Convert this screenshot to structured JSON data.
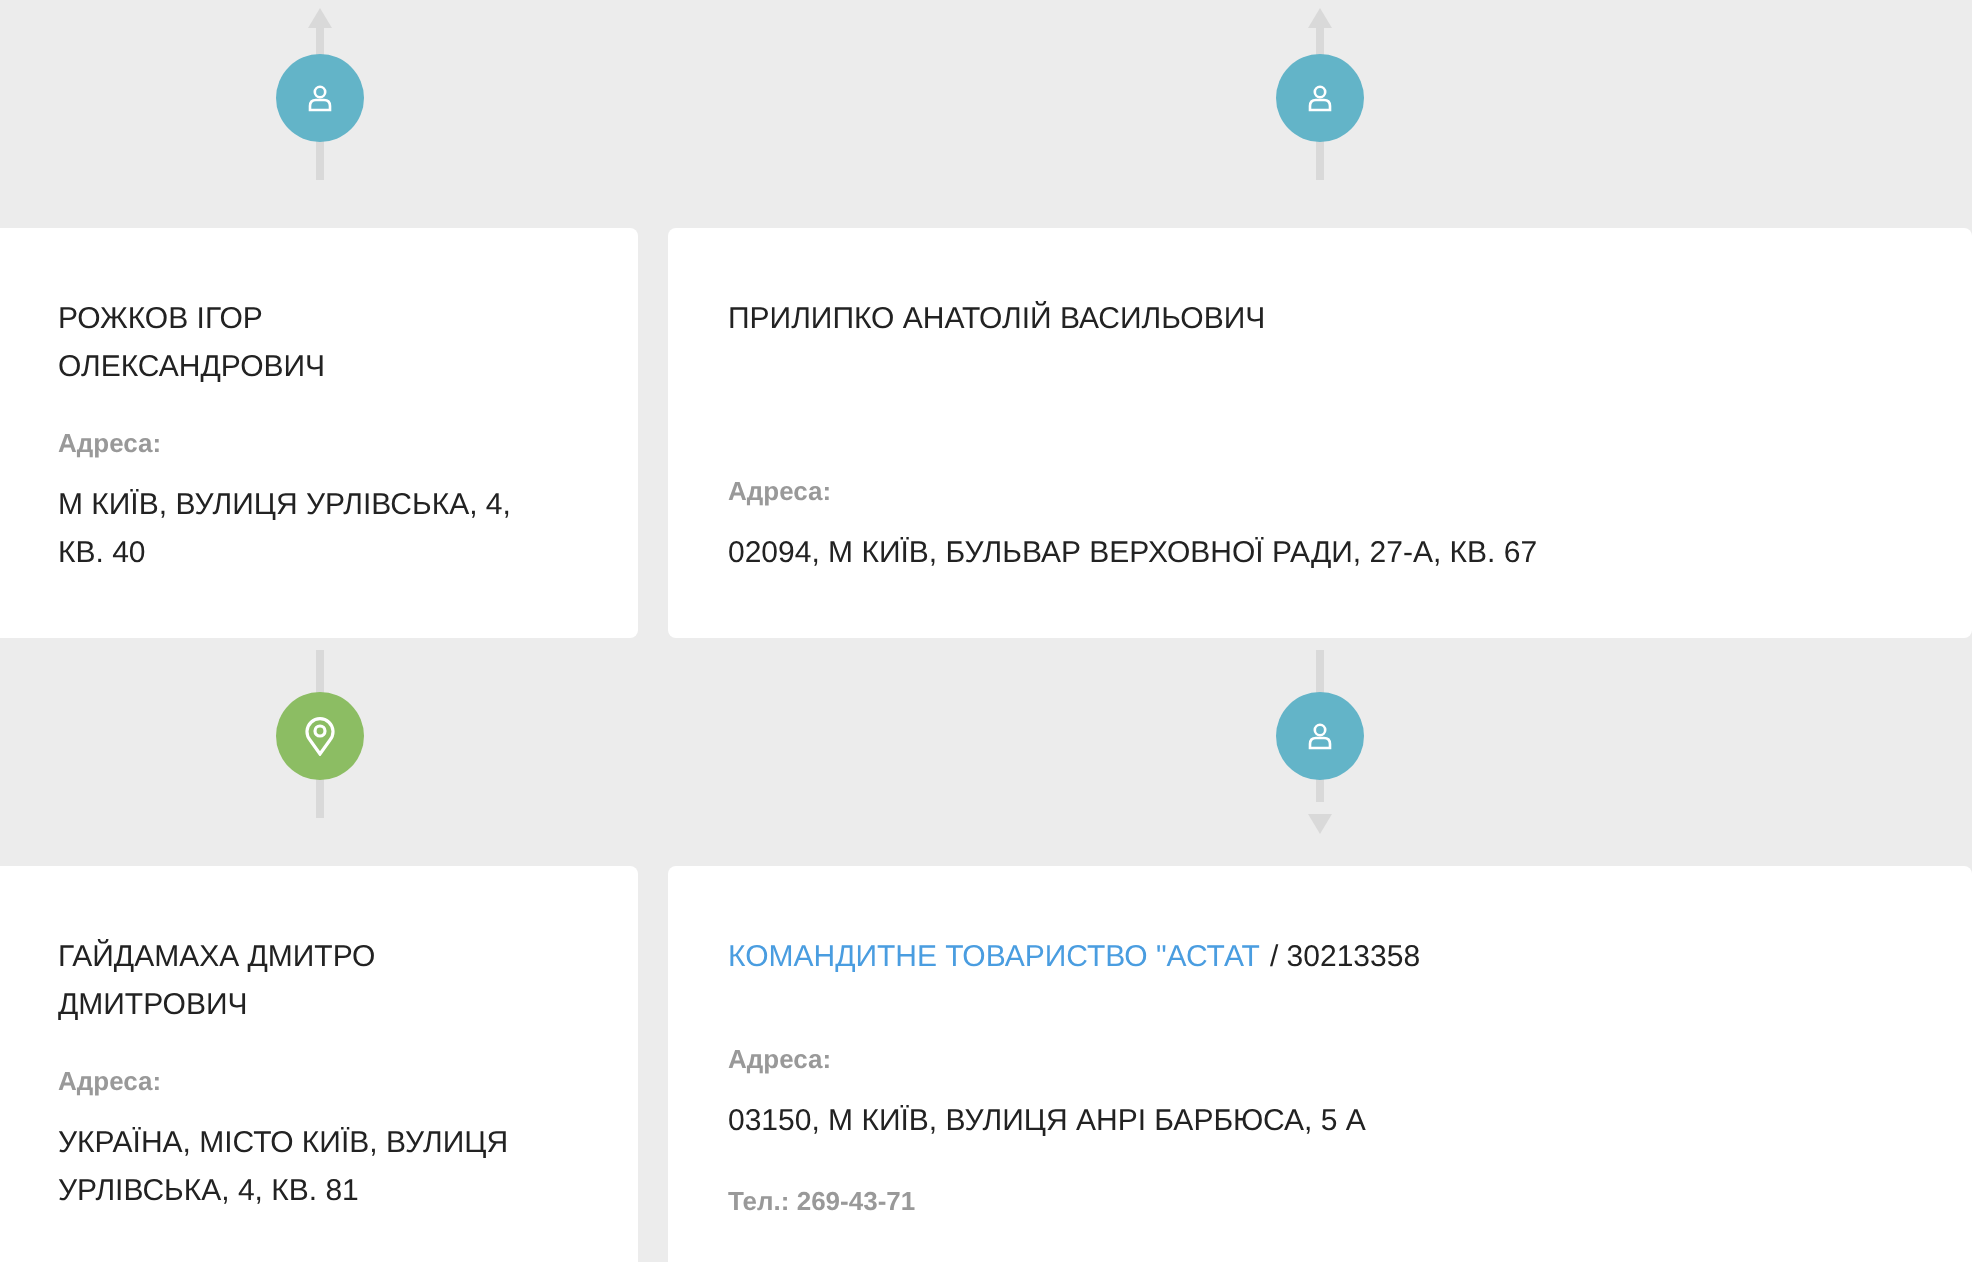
{
  "rows": [
    {
      "items": [
        {
          "connector": {
            "kind": "arrow-up"
          },
          "marker": {
            "kind": "person",
            "color": "#63b4c8"
          },
          "card": {
            "kind": "person",
            "title": "РОЖКОВ ІГОР ОЛЕКСАНДРОВИЧ",
            "address_label": "Адреса:",
            "address": "М КИЇВ, ВУЛИЦЯ УРЛІВСЬКА, 4, КВ. 40"
          }
        },
        {
          "connector": {
            "kind": "arrow-up"
          },
          "marker": {
            "kind": "person",
            "color": "#63b4c8"
          },
          "card": {
            "kind": "person",
            "title": "ПРИЛИПКО АНАТОЛІЙ ВАСИЛЬОВИЧ",
            "address_label": "Адреса:",
            "address": "02094, М КИЇВ, БУЛЬВАР ВЕРХОВНОЇ РАДИ, 27-А, КВ. 67"
          }
        }
      ]
    },
    {
      "items": [
        {
          "connector": {
            "kind": "line"
          },
          "marker": {
            "kind": "location",
            "color": "#8cbd63"
          },
          "card": {
            "kind": "person",
            "title": "ГАЙДАМАХА ДМИТРО ДМИТРОВИЧ",
            "address_label": "Адреса:",
            "address": "УКРАЇНА, МІСТО КИЇВ, ВУЛИЦЯ УРЛІВСЬКА, 4, КВ. 81"
          }
        },
        {
          "connector": {
            "kind": "arrow-down"
          },
          "marker": {
            "kind": "person",
            "color": "#63b4c8"
          },
          "card": {
            "kind": "company",
            "title": "КОМАНДИТНЕ ТОВАРИСТВО \"АСТАТ",
            "code": "/ 30213358",
            "address_label": "Адреса:",
            "address": "03150, М КИЇВ, ВУЛИЦЯ АНРІ БАРБЮСА, 5 А",
            "phone": "Тел.: 269-43-71"
          }
        }
      ]
    }
  ]
}
